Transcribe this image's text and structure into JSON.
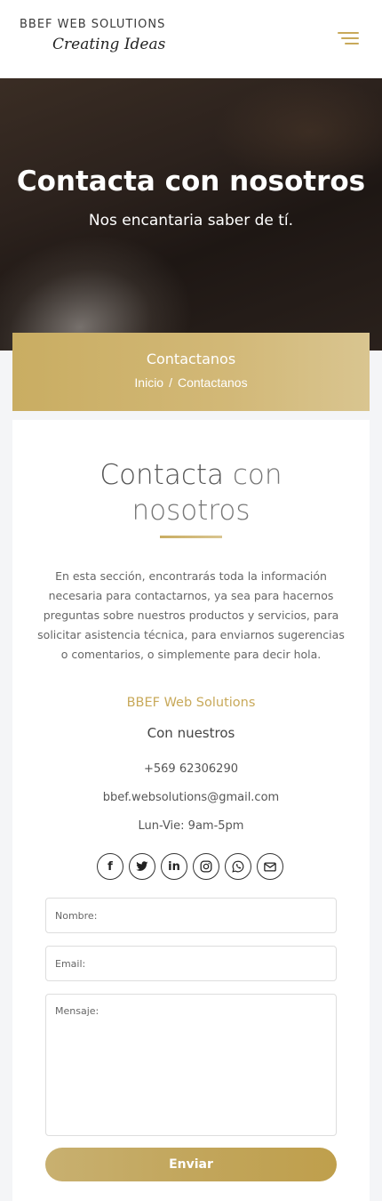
{
  "header": {
    "logo_top": "BBEF WEB SOLUTIONS",
    "logo_bottom": "Creating Ideas",
    "menu_icon": "hamburger-menu-icon",
    "accent_color": "#c8a95a"
  },
  "hero": {
    "title": "Contacta con nosotros",
    "subtitle": "Nos encantaria saber de tí."
  },
  "banner": {
    "title": "Contactanos",
    "breadcrumb": {
      "home": "Inicio",
      "separator": "/",
      "current": "Contactanos"
    }
  },
  "section": {
    "title_strong": "Contacta",
    "title_light_1": "con",
    "title_light_2": "nosotros",
    "intro": "En esta sección, encontrarás toda la información necesaria para contactarnos, ya sea para hacernos preguntas sobre nuestros productos y servicios, para solicitar asistencia técnica, para enviarnos sugerencias o comentarios, o simplemente para decir hola.",
    "company": "BBEF Web Solutions",
    "with_us": "Con nuestros",
    "phone": "+569 62306290",
    "email": "bbef.websolutions@gmail.com",
    "hours": "Lun-Vie: 9am-5pm"
  },
  "socials": [
    {
      "icon": "facebook-icon",
      "glyph": "f"
    },
    {
      "icon": "twitter-icon",
      "glyph": "🐦"
    },
    {
      "icon": "linkedin-icon",
      "glyph": "in"
    },
    {
      "icon": "instagram-icon",
      "glyph": "◎"
    },
    {
      "icon": "whatsapp-icon",
      "glyph": "✆"
    },
    {
      "icon": "email-icon",
      "glyph": "✉"
    }
  ],
  "form": {
    "name_placeholder": "Nombre:",
    "email_placeholder": "Email:",
    "message_placeholder": "Mensaje:",
    "submit_label": "Enviar"
  }
}
